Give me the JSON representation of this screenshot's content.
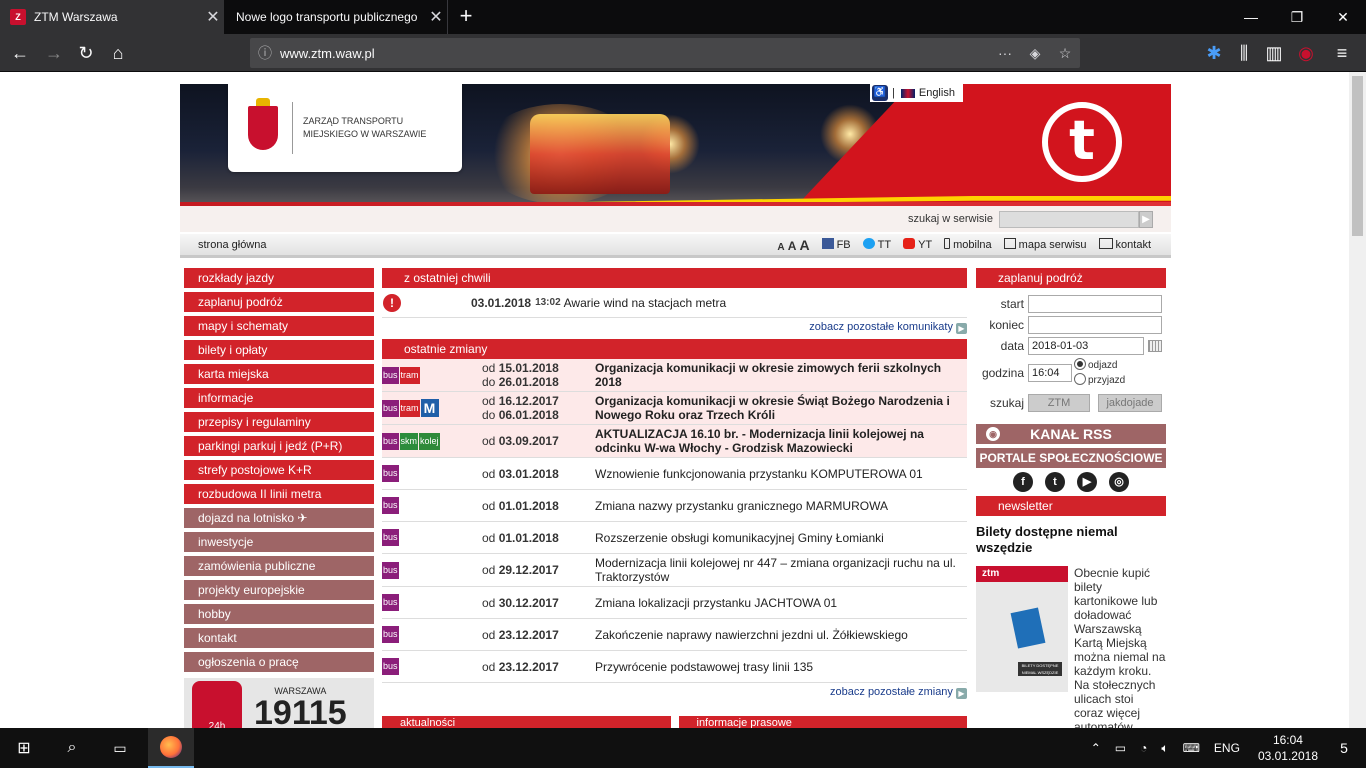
{
  "browser": {
    "tabs": [
      {
        "title": "ZTM Warszawa",
        "active": true
      },
      {
        "title": "Nowe logo transportu publicznego"
      }
    ],
    "url": "www.ztm.waw.pl",
    "fav_letter": "Z"
  },
  "header": {
    "org_name": "ZARZĄD TRANSPORTU MIEJSKIEGO W WARSZAWIE",
    "lang_label": "English",
    "search_label": "szukaj w serwisie"
  },
  "topnav": {
    "home": "strona główna",
    "font_sizes": [
      "A",
      "A",
      "A"
    ],
    "links": {
      "fb": "FB",
      "tt": "TT",
      "yt": "YT",
      "mobile": "mobilna",
      "sitemap": "mapa serwisu",
      "contact": "kontakt"
    }
  },
  "left_menu": [
    {
      "label": "rozkłady jazdy",
      "style": "red"
    },
    {
      "label": "zaplanuj podróż",
      "style": "red"
    },
    {
      "label": "mapy i schematy",
      "style": "red"
    },
    {
      "label": "bilety i opłaty",
      "style": "red"
    },
    {
      "label": "karta miejska",
      "style": "red"
    },
    {
      "label": "informacje",
      "style": "red"
    },
    {
      "label": "przepisy i regulaminy",
      "style": "red"
    },
    {
      "label": "parkingi parkuj i jedź (P+R)",
      "style": "red"
    },
    {
      "label": "strefy postojowe K+R",
      "style": "red"
    },
    {
      "label": "rozbudowa II linii metra",
      "style": "red"
    },
    {
      "label": "dojazd na lotnisko ✈",
      "style": "brown"
    },
    {
      "label": "inwestycje",
      "style": "brown"
    },
    {
      "label": "zamówienia publiczne",
      "style": "brown"
    },
    {
      "label": "projekty europejskie",
      "style": "brown"
    },
    {
      "label": "hobby",
      "style": "brown"
    },
    {
      "label": "kontakt",
      "style": "brown"
    },
    {
      "label": "ogłoszenia o pracę",
      "style": "brown"
    }
  ],
  "callbox": {
    "hours": "24h",
    "number": "19115",
    "city": "WARSZAWA"
  },
  "urgent": {
    "header": "z ostatniej chwili",
    "date": "03.01.2018",
    "time": "13:02",
    "text": "Awarie wind na stacjach metra",
    "more": "zobacz pozostałe komunikaty"
  },
  "changes": {
    "header": "ostatnie zmiany",
    "more": "zobacz pozostałe zmiany",
    "rows": [
      {
        "badges": [
          "bus",
          "tram"
        ],
        "from": "15.01.2018",
        "to": "26.01.2018",
        "text": "Organizacja komunikacji w okresie zimowych ferii szkolnych 2018",
        "bold": true,
        "hl": true
      },
      {
        "badges": [
          "bus",
          "tram",
          "M"
        ],
        "from": "16.12.2017",
        "to": "06.01.2018",
        "text": "Organizacja komunikacji w okresie Świąt Bożego Narodzenia i Nowego Roku oraz Trzech Króli",
        "bold": true,
        "hl": true
      },
      {
        "badges": [
          "bus",
          "skm",
          "kolej"
        ],
        "from": "03.09.2017",
        "to": "",
        "text": "AKTUALIZACJA 16.10 br. - Modernizacja linii kolejowej na odcinku W-wa Włochy - Grodzisk Mazowiecki",
        "bold": true,
        "hl": true
      },
      {
        "badges": [
          "bus"
        ],
        "from": "03.01.2018",
        "to": "",
        "text": "Wznowienie funkcjonowania przystanku KOMPUTEROWA 01",
        "bold": false
      },
      {
        "badges": [
          "bus"
        ],
        "from": "01.01.2018",
        "to": "",
        "text": "Zmiana nazwy przystanku granicznego MARMUROWA",
        "bold": false
      },
      {
        "badges": [
          "bus"
        ],
        "from": "01.01.2018",
        "to": "",
        "text": "Rozszerzenie obsługi komunikacyjnej Gminy Łomianki",
        "bold": false
      },
      {
        "badges": [
          "bus"
        ],
        "from": "29.12.2017",
        "to": "",
        "text": "Modernizacja linii kolejowej nr 447 – zmiana organizacji ruchu na ul. Traktorzystów",
        "bold": false
      },
      {
        "badges": [
          "bus"
        ],
        "from": "30.12.2017",
        "to": "",
        "text": "Zmiana lokalizacji przystanku JACHTOWA 01",
        "bold": false
      },
      {
        "badges": [
          "bus"
        ],
        "from": "23.12.2017",
        "to": "",
        "text": "Zakończenie naprawy nawierzchni jezdni ul. Żółkiewskiego",
        "bold": false
      },
      {
        "badges": [
          "bus"
        ],
        "from": "23.12.2017",
        "to": "",
        "text": "Przywrócenie podstawowej trasy linii 135",
        "bold": false
      }
    ],
    "from_prefix": "od",
    "to_prefix": "do"
  },
  "bottom_headers": [
    "aktualności",
    "informacje prasowe"
  ],
  "planner": {
    "header": "zaplanuj podróż",
    "start_label": "start",
    "end_label": "koniec",
    "date_label": "data",
    "date_value": "2018-01-03",
    "time_label": "godzina",
    "time_value": "16:04",
    "depart": "odjazd",
    "arrive": "przyjazd",
    "search_label": "szukaj",
    "btn_ztm": "ZTM",
    "btn_jakdojade": "jakdojade"
  },
  "rss_label": "KANAŁ RSS",
  "social_label": "PORTALE SPOŁECZNOŚCIOWE",
  "newsletter_label": "newsletter",
  "news": {
    "title": "Bilety dostępne niemal wszędzie",
    "img_brand": "ztm",
    "img_caption": "BILETY DOSTĘPNE NIEMAL WSZĘDZIE",
    "text": "Obecnie kupić bilety kartonikowe lub doładować Warszawską Kartą Miejską można niemal na każdym kroku. Na stołecznych ulicach stoi coraz więcej automatów biletowych, w bardzo"
  },
  "taskbar": {
    "lang": "ENG",
    "time": "16:04",
    "date": "03.01.2018",
    "notif_count": "5"
  }
}
